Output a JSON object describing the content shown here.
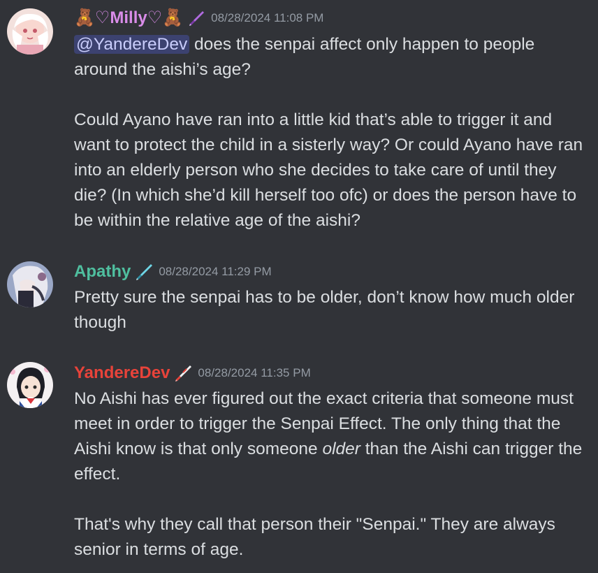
{
  "messages": [
    {
      "username": "🧸♡Milly♡🧸",
      "name_color": "#d98ce8",
      "badge": "purple-knife-icon",
      "timestamp": "08/28/2024 11:08 PM",
      "mention": "@YandereDev",
      "p1_rest": " does the senpai affect only happen to people around the aishi’s age?",
      "p2": "Could Ayano have ran into a little kid that’s able to trigger it and want to protect the child in a sisterly way? Or could Ayano have ran into an elderly person who she decides to take care of until they die? (In which she’d kill herself too ofc) or does the person have to be within the relative age of the aishi?"
    },
    {
      "username": "Apathy",
      "name_color": "#4fbf9f",
      "badge": "teal-knife-icon",
      "timestamp": "08/28/2024 11:29 PM",
      "p1": "Pretty sure the senpai has to be older, don’t know how much older though"
    },
    {
      "username": "YandereDev",
      "name_color": "#e8433a",
      "badge": "red-knife-icon",
      "timestamp": "08/28/2024 11:35 PM",
      "p1_before": "No Aishi has ever figured out the exact criteria that someone must meet in order to trigger the Senpai Effect. The only thing that the Aishi know is that only someone ",
      "p1_em": "older",
      "p1_after": " than the Aishi can trigger the effect.",
      "p2": "That's why they call that person their \"Senpai.\" They are always senior in terms of age."
    }
  ]
}
